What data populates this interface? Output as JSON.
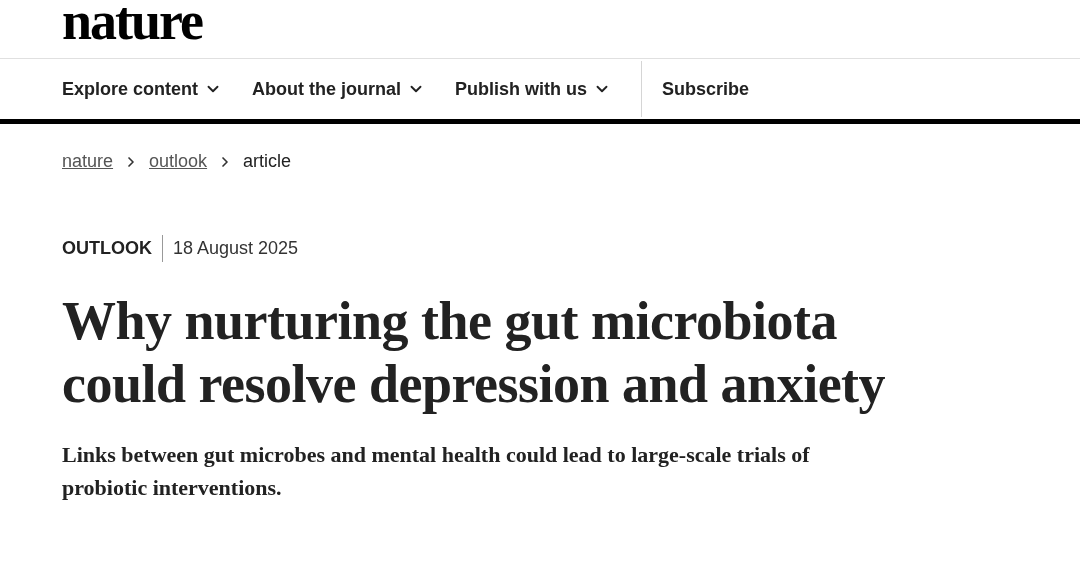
{
  "logo": "nature",
  "nav": [
    {
      "label": "Explore content",
      "kind": "dropdown"
    },
    {
      "label": "About the journal",
      "kind": "dropdown"
    },
    {
      "label": "Publish with us",
      "kind": "dropdown"
    },
    {
      "label": "Subscribe",
      "kind": "link"
    }
  ],
  "breadcrumb": [
    {
      "label": "nature",
      "kind": "link"
    },
    {
      "label": "outlook",
      "kind": "link"
    },
    {
      "label": "article",
      "kind": "current"
    }
  ],
  "article": {
    "type": "OUTLOOK",
    "date": "18 August 2025",
    "title": "Why nurturing the gut microbiota could resolve depression and anxiety",
    "standfirst": "Links between gut microbes and mental health could lead to large-scale trials of probiotic interventions."
  }
}
